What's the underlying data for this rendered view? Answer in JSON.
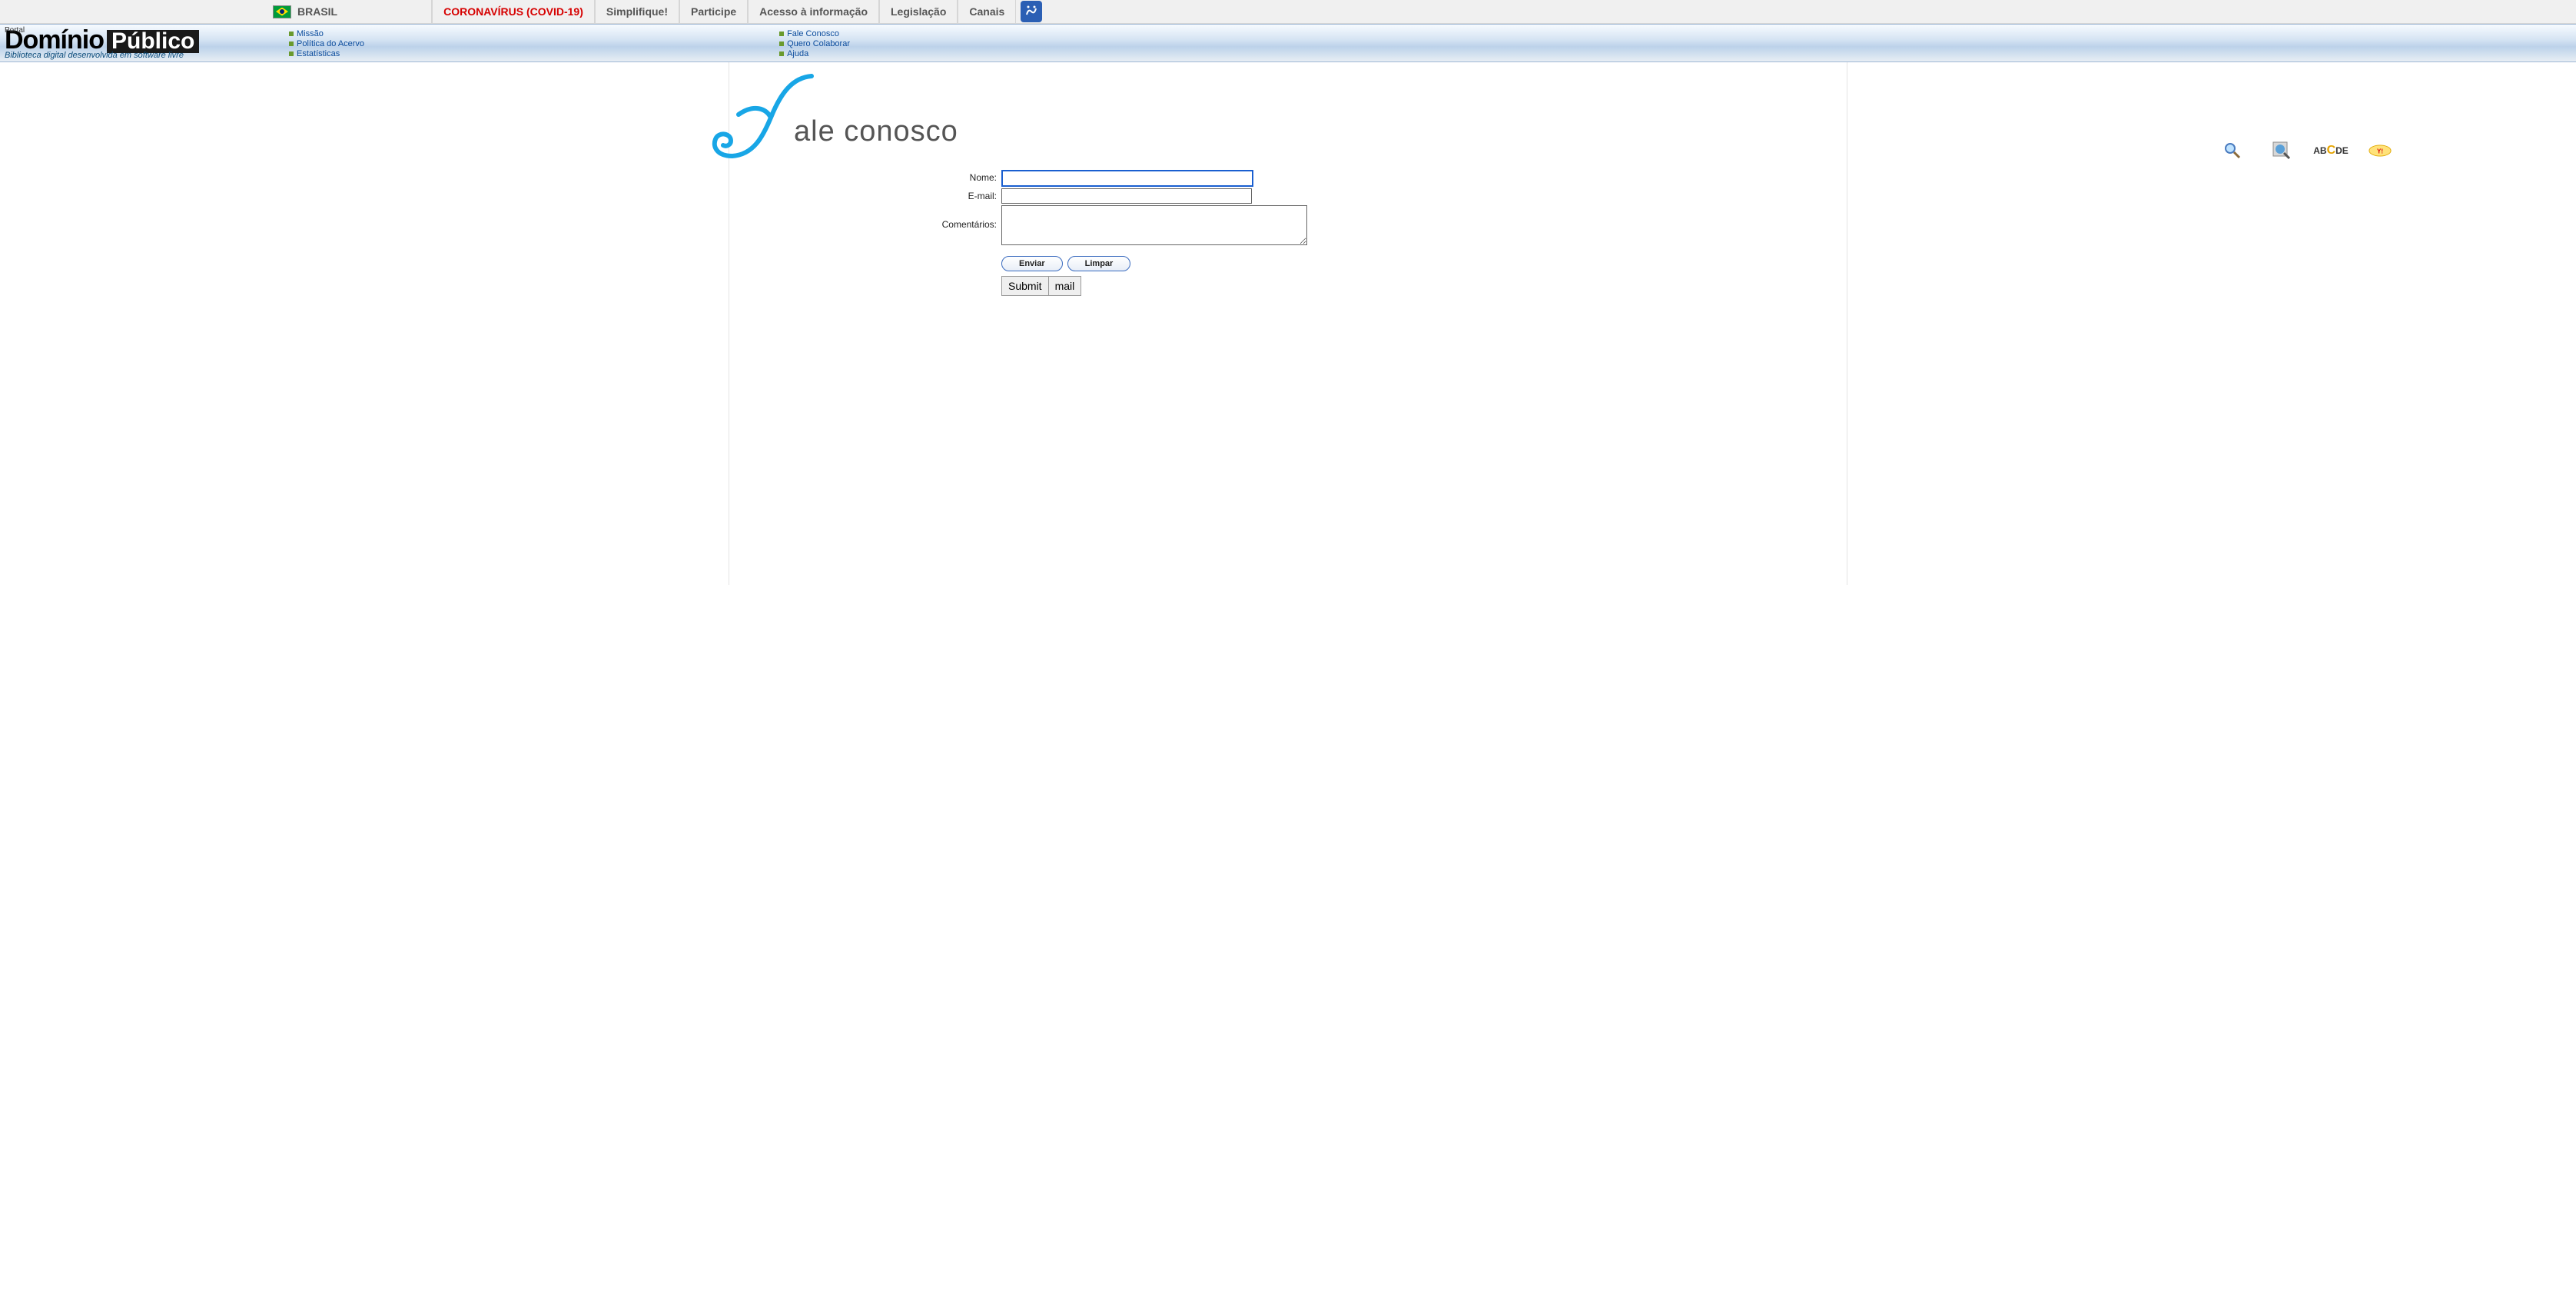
{
  "gov_bar": {
    "country": "BRASIL",
    "items": [
      {
        "label": "CORONAVÍRUS (COVID-19)",
        "highlight": true
      },
      {
        "label": "Simplifique!"
      },
      {
        "label": "Participe"
      },
      {
        "label": "Acesso à informação"
      },
      {
        "label": "Legislação"
      },
      {
        "label": "Canais"
      }
    ]
  },
  "portal_tag": "Portal",
  "logo": {
    "word1": "Domínio",
    "word2": "Público",
    "subtitle": "Biblioteca digital desenvolvida em software livre"
  },
  "site_links_left": [
    {
      "label": "Missão"
    },
    {
      "label": "Política do Acervo"
    },
    {
      "label": "Estatísticas"
    }
  ],
  "site_links_right": [
    {
      "label": "Fale Conosco"
    },
    {
      "label": "Quero Colaborar"
    },
    {
      "label": "Ajuda"
    }
  ],
  "page_title_suffix": "ale conosco",
  "form": {
    "nome_label": "Nome:",
    "email_label": "E-mail:",
    "comentarios_label": "Comentários:",
    "nome_value": "",
    "email_value": "",
    "comentarios_value": "",
    "enviar": "Enviar",
    "limpar": "Limpar",
    "submit": "Submit",
    "mail": "mail"
  },
  "tool_icons": {
    "search": "search-icon",
    "world": "world-search-icon",
    "text_size": "ABCDE",
    "yahoo": "yahoo-search-icon"
  }
}
